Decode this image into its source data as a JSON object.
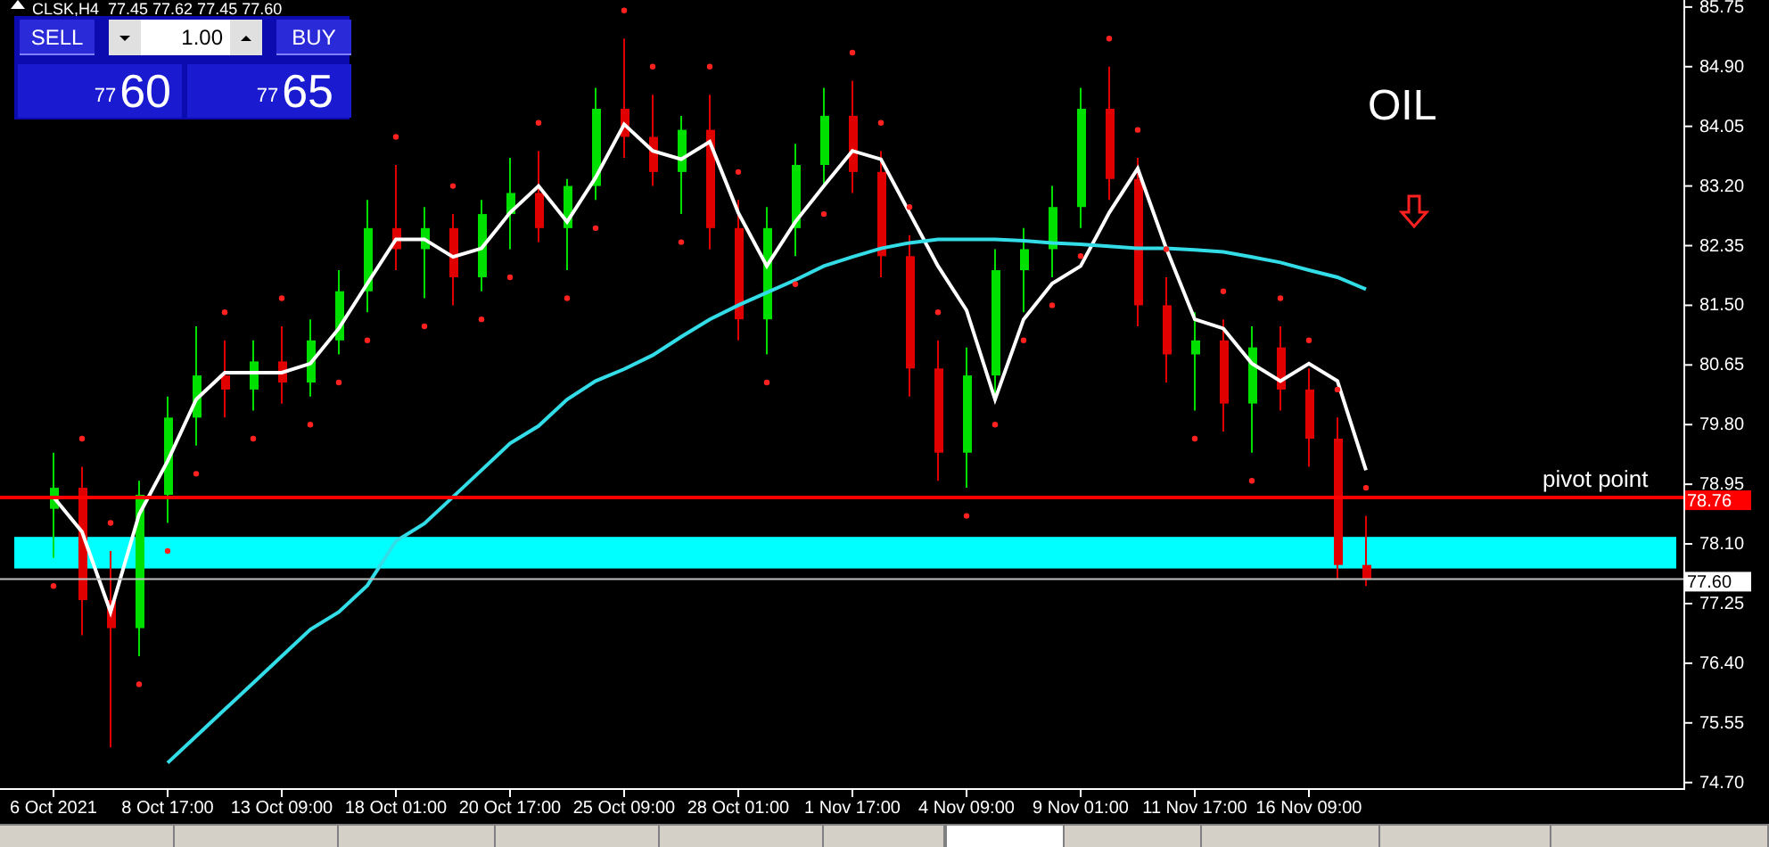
{
  "symbol_bar": {
    "text": "CLSK,H4  77.45 77.62 77.45 77.60"
  },
  "trade_panel": {
    "sell_label": "SELL",
    "buy_label": "BUY",
    "lot": "1.00",
    "sell_price": {
      "small": "77",
      "big": "60"
    },
    "buy_price": {
      "small": "77",
      "big": "65"
    }
  },
  "chart_title": "OIL",
  "pivot_label": "pivot point",
  "chart": {
    "chart_data": {
      "type": "candlestick",
      "categories": [
        "6 Oct 2021",
        null,
        null,
        null,
        "8 Oct 17:00",
        null,
        null,
        null,
        "13 Oct 09:00",
        null,
        null,
        null,
        "18 Oct 01:00",
        null,
        null,
        null,
        "20 Oct 17:00",
        null,
        null,
        null,
        "25 Oct 09:00",
        null,
        null,
        null,
        "28 Oct 01:00",
        null,
        null,
        null,
        "1 Nov 17:00",
        null,
        null,
        null,
        "4 Nov 09:00",
        null,
        null,
        null,
        "9 Nov 01:00",
        null,
        null,
        null,
        "11 Nov 17:00",
        null,
        null,
        null,
        "16 Nov 09:00",
        null,
        null
      ],
      "ohlc": [
        [
          78.6,
          79.4,
          77.9,
          78.9
        ],
        [
          78.9,
          79.2,
          76.8,
          77.3
        ],
        [
          77.3,
          78.0,
          75.2,
          76.9
        ],
        [
          76.9,
          79.0,
          76.5,
          78.8
        ],
        [
          78.8,
          80.2,
          78.4,
          79.9
        ],
        [
          79.9,
          81.2,
          79.5,
          80.5
        ],
        [
          80.5,
          81.0,
          79.9,
          80.3
        ],
        [
          80.3,
          81.0,
          80.0,
          80.7
        ],
        [
          80.7,
          81.2,
          80.1,
          80.4
        ],
        [
          80.4,
          81.3,
          80.2,
          81.0
        ],
        [
          81.0,
          82.0,
          80.8,
          81.7
        ],
        [
          81.7,
          83.0,
          81.4,
          82.6
        ],
        [
          82.6,
          83.5,
          82.0,
          82.3
        ],
        [
          82.3,
          82.9,
          81.6,
          82.6
        ],
        [
          82.6,
          82.8,
          81.5,
          81.9
        ],
        [
          81.9,
          83.0,
          81.7,
          82.8
        ],
        [
          82.8,
          83.6,
          82.3,
          83.1
        ],
        [
          83.1,
          83.7,
          82.4,
          82.6
        ],
        [
          82.6,
          83.3,
          82.0,
          83.2
        ],
        [
          83.2,
          84.6,
          83.0,
          84.3
        ],
        [
          84.3,
          85.3,
          83.6,
          83.9
        ],
        [
          83.9,
          84.5,
          83.2,
          83.4
        ],
        [
          83.4,
          84.2,
          82.8,
          84.0
        ],
        [
          84.0,
          84.5,
          82.3,
          82.6
        ],
        [
          82.6,
          83.0,
          81.0,
          81.3
        ],
        [
          81.3,
          82.9,
          80.8,
          82.6
        ],
        [
          82.6,
          83.8,
          82.2,
          83.5
        ],
        [
          83.5,
          84.6,
          83.2,
          84.2
        ],
        [
          84.2,
          84.7,
          83.1,
          83.4
        ],
        [
          83.4,
          83.7,
          81.9,
          82.2
        ],
        [
          82.2,
          82.5,
          80.2,
          80.6
        ],
        [
          80.6,
          81.0,
          79.0,
          79.4
        ],
        [
          79.4,
          80.9,
          78.9,
          80.5
        ],
        [
          80.5,
          82.3,
          80.2,
          82.0
        ],
        [
          82.0,
          82.6,
          81.4,
          82.3
        ],
        [
          82.3,
          83.2,
          81.9,
          82.9
        ],
        [
          82.9,
          84.6,
          82.6,
          84.3
        ],
        [
          84.3,
          84.9,
          83.0,
          83.3
        ],
        [
          83.3,
          83.6,
          81.2,
          81.5
        ],
        [
          81.5,
          81.9,
          80.4,
          80.8
        ],
        [
          80.8,
          81.4,
          80.0,
          81.0
        ],
        [
          81.0,
          81.3,
          79.7,
          80.1
        ],
        [
          80.1,
          81.2,
          79.4,
          80.9
        ],
        [
          80.9,
          81.2,
          80.0,
          80.3
        ],
        [
          80.3,
          80.6,
          79.2,
          79.6
        ],
        [
          79.6,
          79.9,
          77.6,
          77.8
        ],
        [
          77.8,
          78.5,
          77.5,
          77.6
        ]
      ],
      "series": [
        {
          "type": "line",
          "color": "#ffffff",
          "values": [
            78.77,
            78.27,
            77.13,
            78.52,
            79.28,
            80.16,
            80.54,
            80.54,
            80.54,
            80.67,
            81.17,
            81.81,
            82.44,
            82.44,
            82.19,
            82.31,
            82.82,
            83.2,
            82.69,
            83.32,
            84.08,
            83.7,
            83.58,
            83.83,
            82.82,
            82.06,
            82.69,
            83.2,
            83.7,
            83.58,
            82.82,
            82.06,
            81.43,
            80.16,
            81.3,
            81.81,
            82.06,
            82.82,
            83.45,
            82.31,
            81.3,
            81.17,
            80.67,
            80.42,
            80.67,
            80.42,
            79.15
          ]
        },
        {
          "type": "line",
          "color": "#33dde8",
          "values": [
            null,
            null,
            null,
            null,
            74.98,
            75.36,
            75.74,
            76.12,
            76.5,
            76.88,
            77.13,
            77.51,
            78.14,
            78.39,
            78.77,
            79.15,
            79.53,
            79.78,
            80.16,
            80.42,
            80.59,
            80.79,
            81.05,
            81.3,
            81.5,
            81.68,
            81.86,
            82.06,
            82.19,
            82.31,
            82.39,
            82.44,
            82.44,
            82.44,
            82.42,
            82.39,
            82.37,
            82.34,
            82.31,
            82.31,
            82.29,
            82.26,
            82.19,
            82.11,
            82.0,
            81.9,
            81.73
          ]
        },
        {
          "type": "scatter",
          "color": "#ff2020",
          "values": [
            77.5,
            79.6,
            78.4,
            76.1,
            78.0,
            79.1,
            81.4,
            79.6,
            81.6,
            79.8,
            80.4,
            81.0,
            83.9,
            81.2,
            83.2,
            81.3,
            81.9,
            84.1,
            81.6,
            82.6,
            85.7,
            84.9,
            82.4,
            84.9,
            83.4,
            80.4,
            81.8,
            82.8,
            85.1,
            84.1,
            82.9,
            81.4,
            78.5,
            79.8,
            81.0,
            81.5,
            82.2,
            85.3,
            84.0,
            82.3,
            79.6,
            81.7,
            79.0,
            81.6,
            81.0,
            80.3,
            78.9
          ]
        }
      ],
      "ylim": [
        74.62,
        85.85
      ],
      "yticks": [
        {
          "value": 85.75,
          "label": "85.75"
        },
        {
          "value": 84.9,
          "label": "84.90"
        },
        {
          "value": 84.05,
          "label": "84.05"
        },
        {
          "value": 83.2,
          "label": "83.20"
        },
        {
          "value": 82.35,
          "label": "82.35"
        },
        {
          "value": 81.5,
          "label": "81.50"
        },
        {
          "value": 80.65,
          "label": "80.65"
        },
        {
          "value": 79.8,
          "label": "79.80"
        },
        {
          "value": 78.95,
          "label": "78.95"
        },
        {
          "value": 78.1,
          "label": "78.10"
        },
        {
          "value": 77.25,
          "label": "77.25"
        },
        {
          "value": 76.4,
          "label": "76.40"
        },
        {
          "value": 75.55,
          "label": "75.55"
        },
        {
          "value": 74.7,
          "label": "74.70"
        }
      ],
      "bands": [
        {
          "axis": "y",
          "from": 77.75,
          "to": 78.2,
          "color": "#00ffff"
        }
      ],
      "ref_lines": [
        {
          "axis": "y",
          "value": 78.76,
          "label": "78.76",
          "color": "#ff0000"
        },
        {
          "axis": "y",
          "value": 77.6,
          "label": "77.60",
          "color": "#c0c0c0"
        }
      ]
    }
  },
  "signal_arrow": {
    "color": "#ff2020"
  },
  "tabs": [
    {
      "selected": false
    },
    {
      "selected": false
    },
    {
      "selected": false
    },
    {
      "selected": false
    },
    {
      "selected": false
    },
    {
      "selected": false
    },
    {
      "selected": true
    },
    {
      "selected": false
    },
    {
      "selected": false
    },
    {
      "selected": false
    },
    {
      "selected": false
    }
  ]
}
